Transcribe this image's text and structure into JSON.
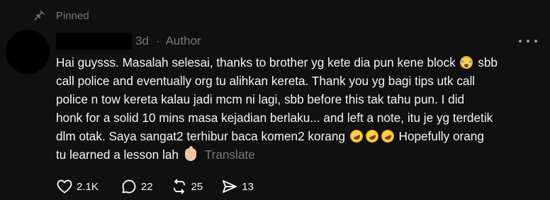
{
  "pinned": {
    "label": "Pinned",
    "icon": "pin-icon"
  },
  "post": {
    "time": "3d",
    "separator": "·",
    "author_badge": "Author",
    "lines": [
      "Hai guysss. Masalah selesai, thanks to brother yg kete dia pun kene block",
      "sbb",
      "call police and eventually org tu alihkan kereta. Thank you yg bagi tips utk call",
      "police n tow kereta kalau jadi mcm ni lagi, sbb before this tak tahu pun. I did",
      "honk for a solid 10 mins masa kejadian berlaku... and left a note, itu je yg terdetik",
      "dlm otak. Saya sangat2 terhibur baca komen2 korang",
      "Hopefully orang",
      "tu learned a lesson lah"
    ],
    "translate_label": "Translate"
  },
  "actions": {
    "likes": "2.1K",
    "replies": "22",
    "reposts": "25",
    "shares": "13"
  },
  "colors": {
    "background": "#101010",
    "text": "#f3f5f7",
    "muted": "#777777"
  }
}
